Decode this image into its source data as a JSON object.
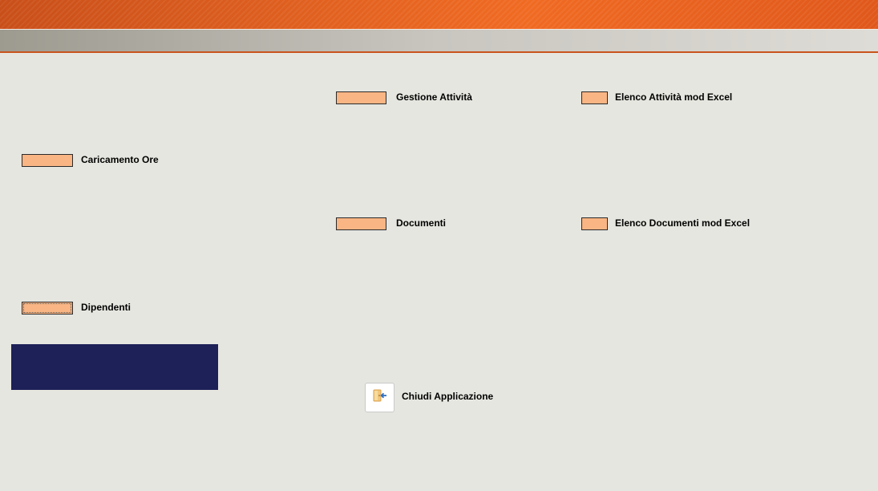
{
  "menu": {
    "gestione_attivita": "Gestione Attività",
    "elenco_attivita_excel": "Elenco Attività mod Excel",
    "caricamento_ore": "Caricamento Ore",
    "documenti": "Documenti",
    "elenco_documenti_excel": "Elenco Documenti mod Excel",
    "dipendenti": "Dipendenti",
    "chiudi_applicazione": "Chiudi Applicazione"
  },
  "icons": {
    "exit": "exit-door-icon"
  },
  "colors": {
    "banner_orange": "#e0601f",
    "button_fill": "#f9b584",
    "navy_panel": "#1e2058",
    "background": "#e6e6e0"
  }
}
